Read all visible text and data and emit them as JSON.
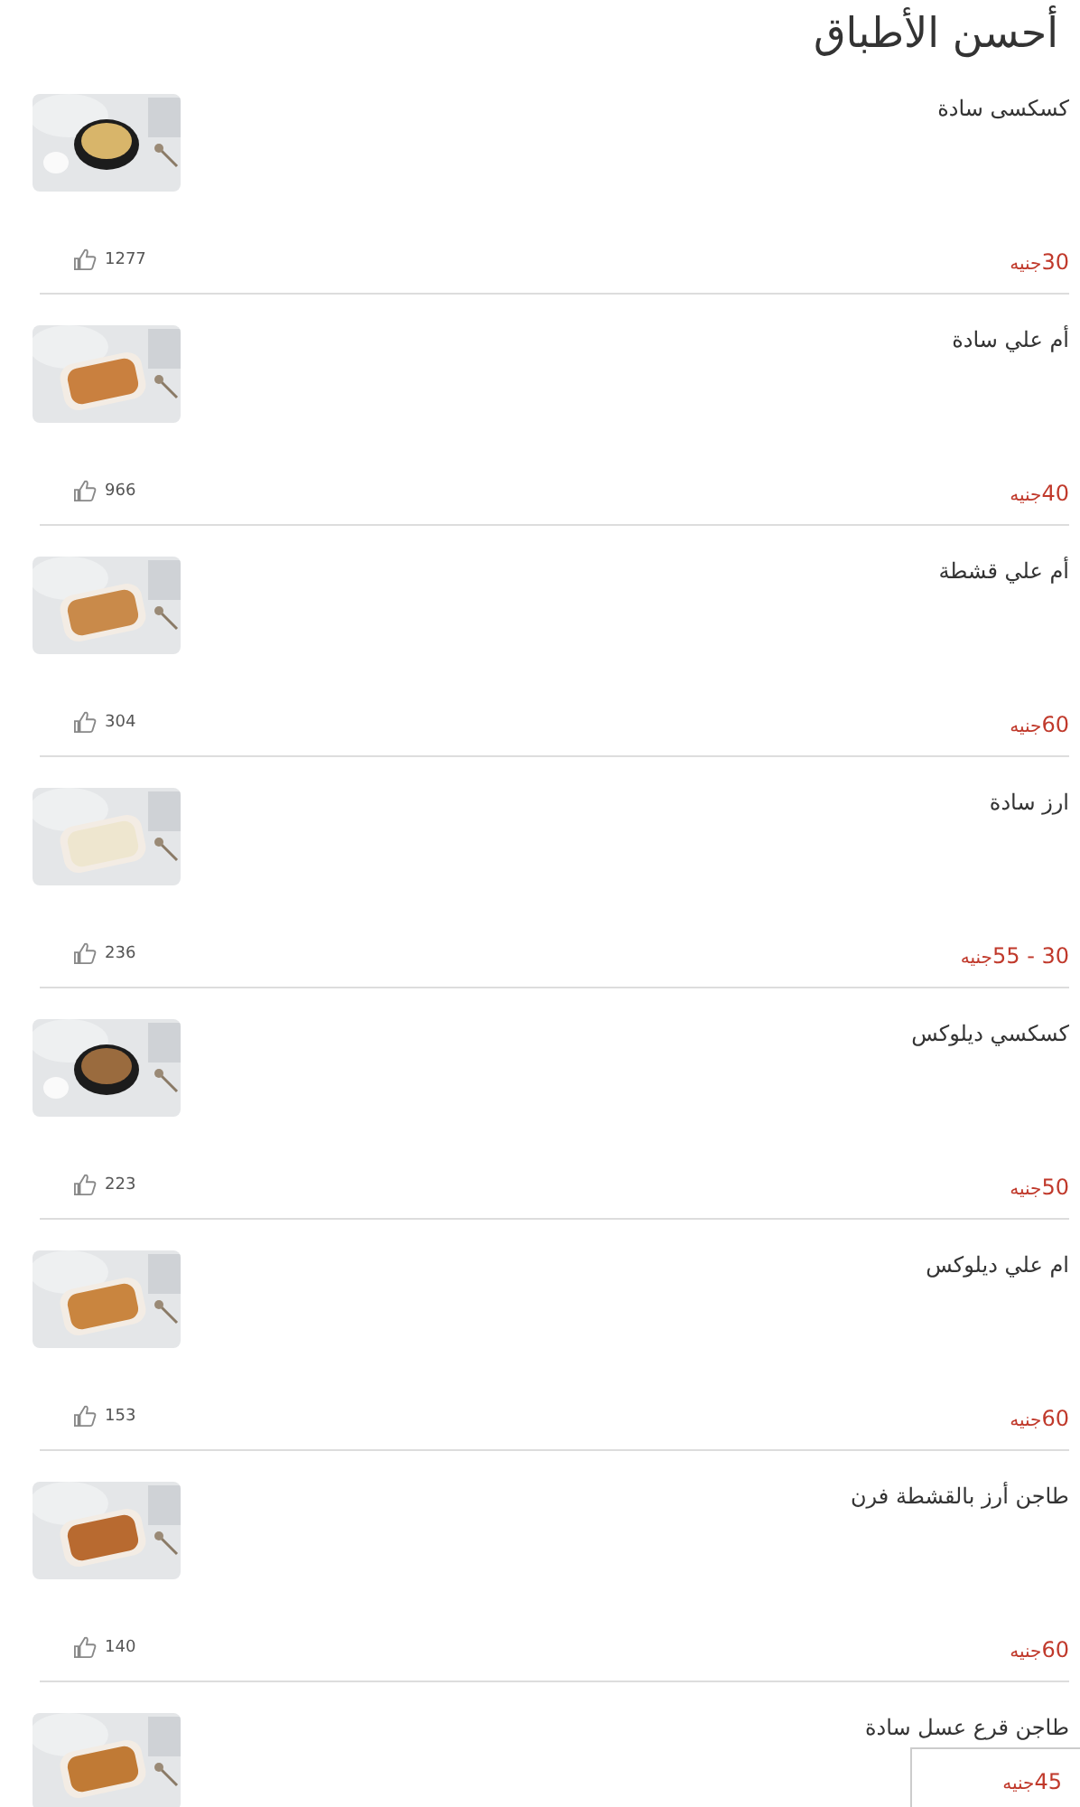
{
  "title": "أحسن الأطباق",
  "dishes": [
    {
      "name": "كسكسى سادة",
      "price": "30",
      "currency": "جنيه",
      "likes": "1277",
      "kind": "picture"
    },
    {
      "name": "أم علي سادة",
      "price": "40",
      "currency": "جنيه",
      "likes": "966",
      "kind": "picture"
    },
    {
      "name": "أم علي قشطة",
      "price": "60",
      "currency": "جنيه",
      "likes": "304",
      "kind": "picture"
    },
    {
      "name": "ارز سادة",
      "price": "30 - 55",
      "currency": "جنيه",
      "likes": "236",
      "kind": "picture"
    },
    {
      "name": "كسكسي ديلوكس",
      "price": "50",
      "currency": "جنيه",
      "likes": "223",
      "kind": "picture"
    },
    {
      "name": "ام علي ديلوكس",
      "price": "60",
      "currency": "جنيه",
      "likes": "153",
      "kind": "picture"
    },
    {
      "name": "طاجن أرز بالقشطة فرن",
      "price": "60",
      "currency": "جنيه",
      "likes": "140",
      "kind": "picture"
    },
    {
      "name": "طاجن قرع عسل سادة",
      "kind": "picture"
    }
  ],
  "floating_panel": {
    "price": "45",
    "currency": "جنيه"
  }
}
